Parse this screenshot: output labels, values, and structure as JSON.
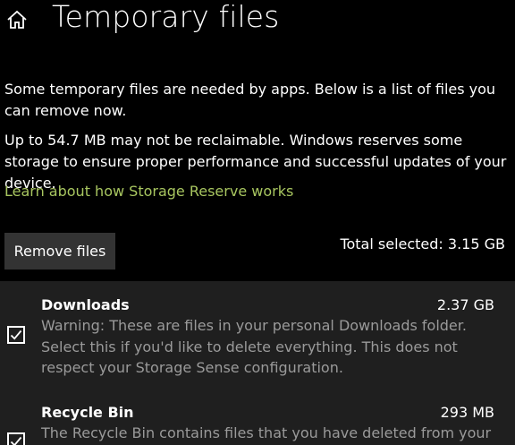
{
  "header": {
    "title": "Temporary files",
    "home_icon": "home-icon"
  },
  "intro": {
    "text": "Some temporary files are needed by apps. Below is a list of files you can remove now.",
    "reserve_text": "Up to 54.7 MB may not be reclaimable. Windows reserves some storage to ensure proper performance and successful updates of your device.",
    "learn_link": "Learn about how Storage Reserve works"
  },
  "actions": {
    "remove_label": "Remove files",
    "total_selected": "Total selected: 3.15 GB"
  },
  "items": [
    {
      "name": "Downloads",
      "size": "2.37 GB",
      "description": "Warning: These are files in your personal Downloads folder. Select this if you'd like to delete everything. This does not respect your Storage Sense configuration.",
      "checked": true
    },
    {
      "name": "Recycle Bin",
      "size": "293 MB",
      "description": "The Recycle Bin contains files that you have deleted from your",
      "checked": true
    }
  ],
  "colors": {
    "background": "#000000",
    "panel": "#1f1f1f",
    "button": "#333333",
    "link": "#a8c660",
    "secondary_text": "#9a9a9a"
  }
}
